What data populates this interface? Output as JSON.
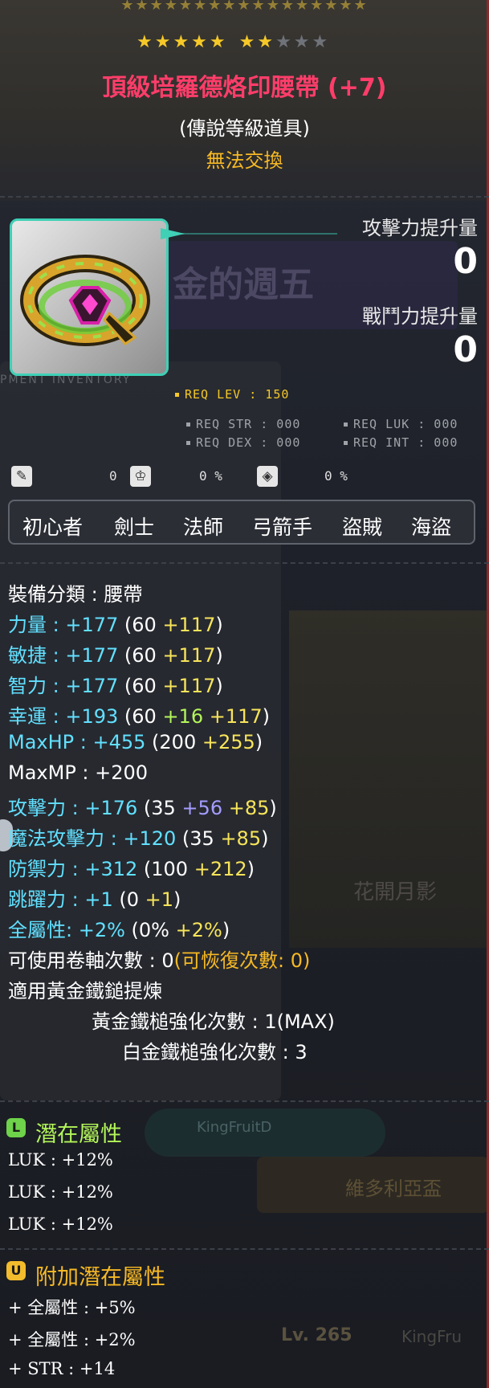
{
  "top_stars": "★★★★★★★★★★★★★★★★★",
  "stars": {
    "row1": "★★★★★",
    "row2_on": "★★",
    "row2_off": "★★★"
  },
  "item": {
    "name": "頂級培羅德烙印腰帶 (+7)",
    "grade": "(傳說等級道具)",
    "trade": "無法交換"
  },
  "background": {
    "banner": "金的週五",
    "inventory": "PMENT INVENTORY",
    "flower": "花開月影",
    "king": "KingFruitD",
    "v": "維多利亞盃",
    "lv": "Lv. 265",
    "player": "KingFru"
  },
  "power": {
    "attack_label": "攻擊力提升量",
    "attack_value": "0",
    "combat_label": "戰鬥力提升量",
    "combat_value": "0"
  },
  "requirements": {
    "lev": "REQ LEV : 150",
    "str": "REQ STR : 000",
    "luk": "REQ LUK : 000",
    "dex": "REQ DEX : 000",
    "int": "REQ INT : 000"
  },
  "chips": {
    "v1": "0",
    "v2": "0 %",
    "v3": "0 %"
  },
  "jobs": [
    "初心者",
    "劍士",
    "法師",
    "弓箭手",
    "盜賊",
    "海盜"
  ],
  "stats": {
    "category": "裝備分類 : 腰帶",
    "str": {
      "label": "力量 : +177",
      "base": "(60 ",
      "bonus": "+117",
      "close": ")"
    },
    "dex": {
      "label": "敏捷 : +177",
      "base": "(60 ",
      "bonus": "+117",
      "close": ")"
    },
    "int": {
      "label": "智力 : +177",
      "base": "(60 ",
      "bonus": "+117",
      "close": ")"
    },
    "luk": {
      "label": "幸運 : +193",
      "base": "(60 ",
      "flame": "+16",
      "bonus": "+117",
      "close": ")"
    },
    "maxhp": {
      "label": "MaxHP : +455",
      "base": "(200 ",
      "bonus": "+255",
      "close": ")"
    },
    "maxmp": "MaxMP : +200",
    "atk": {
      "label": "攻擊力 : +176",
      "base": "(35 ",
      "flame": "+56",
      "bonus": "+85",
      "close": ")"
    },
    "matk": {
      "label": "魔法攻擊力 : +120",
      "base": "(35 ",
      "bonus": "+85",
      "close": ")"
    },
    "def": {
      "label": "防禦力 : +312",
      "base": "(100 ",
      "bonus": "+212",
      "close": ")"
    },
    "jump": {
      "label": "跳躍力 : +1",
      "base": "(0 ",
      "bonus": "+1",
      "close": ")"
    },
    "all": {
      "label": "全屬性: +2%",
      "base": "(0% ",
      "bonus": "+2%",
      "close": ")"
    },
    "scroll": "可使用卷軸次數 : 0",
    "scroll_restore": "(可恢復次數: 0)",
    "golden_hammer": "適用黃金鐵鎚提煉",
    "golden_count": "黃金鐵槌強化次數 : 1(MAX)",
    "platinum_count": "白金鐵槌強化次數 : 3"
  },
  "potential": {
    "title": "潛在屬性",
    "icon": "L",
    "lines": [
      "LUK : +12%",
      "LUK : +12%",
      "LUK : +12%"
    ]
  },
  "additional": {
    "title": "附加潛在屬性",
    "icon": "U",
    "lines": [
      "+ 全屬性 : +5%",
      "+ 全屬性 : +2%",
      "+ STR : +14"
    ]
  },
  "colors": {
    "item_name": "#ff3d6a",
    "legendary_frame": "#3fd0b6",
    "stat_cyan": "#61e0ff",
    "bonus_yellow": "#f7e45a",
    "flame_green": "#b3f55a",
    "star_purple": "#a49cff",
    "potential_green": "#6ed24a",
    "additional_gold": "#f2bc2c"
  }
}
